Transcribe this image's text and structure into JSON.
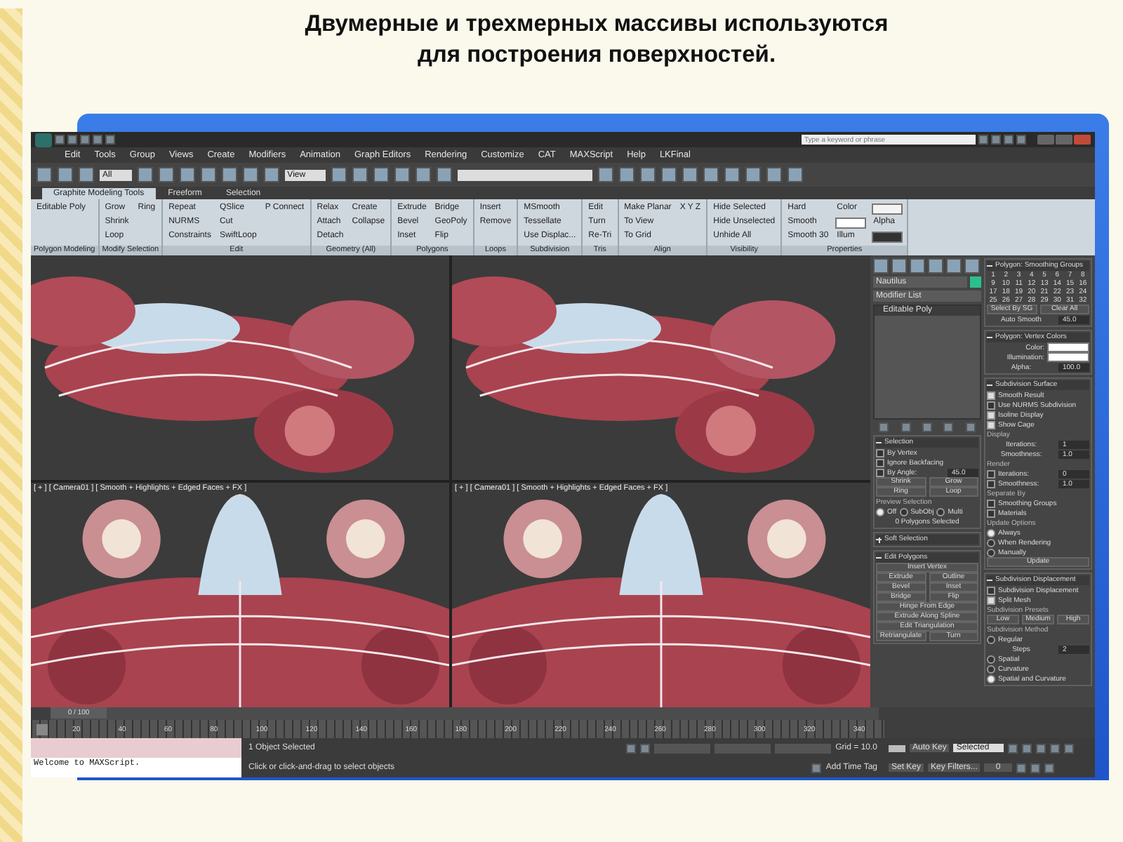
{
  "slide": {
    "title": "Двумерные и трехмерных массивы используются для построения поверхностей."
  },
  "app": {
    "search": {
      "placeholder": "Type a keyword or phrase"
    },
    "menu": [
      "Edit",
      "Tools",
      "Group",
      "Views",
      "Create",
      "Modifiers",
      "Animation",
      "Graph Editors",
      "Rendering",
      "Customize",
      "CAT",
      "MAXScript",
      "Help",
      "LKFinal"
    ],
    "toolbar": {
      "selection_filter": "All",
      "reference_coord": "View"
    },
    "ribbon_tabs": [
      {
        "label": "Graphite Modeling Tools",
        "selected": true
      },
      {
        "label": "Freeform",
        "selected": false
      },
      {
        "label": "Selection",
        "selected": false
      }
    ],
    "ribbon_groups": [
      {
        "label": "Polygon Modeling",
        "items": [
          {
            "text": "Editable Poly"
          }
        ]
      },
      {
        "label": "Modify Selection",
        "items": [
          {
            "text": "Grow"
          },
          {
            "text": "Shrink"
          },
          {
            "text": "Loop"
          },
          {
            "text": "Ring"
          }
        ]
      },
      {
        "label": "Edit",
        "items": [
          {
            "text": "Repeat"
          },
          {
            "text": "NURMS"
          },
          {
            "text": "Constraints"
          },
          {
            "text": "QSlice"
          },
          {
            "text": "Cut"
          },
          {
            "text": "SwiftLoop"
          },
          {
            "text": "P Connect"
          }
        ]
      },
      {
        "label": "Geometry (All)",
        "items": [
          {
            "text": "Relax"
          },
          {
            "text": "Attach"
          },
          {
            "text": "Detach"
          },
          {
            "text": "Create"
          },
          {
            "text": "Collapse"
          }
        ]
      },
      {
        "label": "Polygons",
        "items": [
          {
            "text": "Extrude"
          },
          {
            "text": "Bevel"
          },
          {
            "text": "Inset"
          },
          {
            "text": "Bridge"
          },
          {
            "text": "GeoPoly"
          },
          {
            "text": "Flip"
          }
        ]
      },
      {
        "label": "Loops",
        "items": [
          {
            "text": "Insert"
          },
          {
            "text": "Remove"
          }
        ]
      },
      {
        "label": "Subdivision",
        "items": [
          {
            "text": "MSmooth"
          },
          {
            "text": "Tessellate"
          },
          {
            "text": "Use Displac..."
          }
        ]
      },
      {
        "label": "Tris",
        "items": [
          {
            "text": "Edit"
          },
          {
            "text": "Turn"
          },
          {
            "text": "Re-Tri"
          }
        ]
      },
      {
        "label": "Align",
        "items": [
          {
            "text": "Make Planar"
          },
          {
            "text": "To View"
          },
          {
            "text": "To Grid"
          },
          {
            "text": "X Y Z"
          }
        ]
      },
      {
        "label": "Visibility",
        "items": [
          {
            "text": "Hide Selected"
          },
          {
            "text": "Hide Unselected"
          },
          {
            "text": "Unhide All"
          }
        ]
      },
      {
        "label": "Properties",
        "items": [
          {
            "text": "Hard"
          },
          {
            "text": "Smooth"
          },
          {
            "text": "Smooth 30"
          },
          {
            "text": "Color",
            "kind": "swatch",
            "color": "#ffffff"
          },
          {
            "text": "Illum",
            "kind": "swatch",
            "color": "#f4f4f4"
          },
          {
            "text": "Alpha",
            "kind": "swatch",
            "color": "#333333"
          }
        ]
      }
    ],
    "viewports": [
      {
        "kind": "picture"
      },
      {
        "kind": "picture"
      },
      {
        "kind": "picture",
        "label": "[ + ] [ Camera01 ] [ Smooth + Highlights + Edged Faces + FX ]"
      },
      {
        "kind": "picture",
        "label": "[ + ] [ Camera01 ] [ Smooth + Highlights + Edged Faces + FX ]"
      }
    ],
    "command_panel": {
      "object_name": "Nautilus",
      "modifier_list": "Modifier List",
      "stack": [
        "Editable Poly"
      ],
      "left_rollouts": [
        {
          "title": "Selection",
          "expanded": true,
          "rows": [
            {
              "kind": "check",
              "text": "By Vertex",
              "checked": false
            },
            {
              "kind": "check",
              "text": "Ignore Backfacing",
              "checked": false
            },
            {
              "kind": "checkfield",
              "text": "By Angle:",
              "value": "45.0",
              "checked": false
            },
            {
              "kind": "buttons",
              "items": [
                "Shrink",
                "Grow"
              ]
            },
            {
              "kind": "buttons",
              "items": [
                "Ring",
                "Loop"
              ]
            },
            {
              "kind": "label",
              "text": "Preview Selection"
            },
            {
              "kind": "radios",
              "items": [
                {
                  "text": "Off",
                  "selected": true
                },
                {
                  "text": "SubObj",
                  "selected": false
                },
                {
                  "text": "Multi",
                  "selected": false
                }
              ]
            },
            {
              "kind": "note",
              "text": "0 Polygons Selected"
            }
          ]
        },
        {
          "title": "Soft Selection",
          "expanded": false
        },
        {
          "title": "Edit Polygons",
          "expanded": true,
          "rows": [
            {
              "kind": "buttons",
              "items": [
                "Insert Vertex"
              ]
            },
            {
              "kind": "buttons",
              "items": [
                "Extrude",
                "Outline"
              ]
            },
            {
              "kind": "buttons",
              "items": [
                "Bevel",
                "Inset"
              ]
            },
            {
              "kind": "buttons",
              "items": [
                "Bridge",
                "Flip"
              ]
            },
            {
              "kind": "buttons",
              "items": [
                "Hinge From Edge"
              ]
            },
            {
              "kind": "buttons",
              "items": [
                "Extrude Along Spline"
              ]
            },
            {
              "kind": "buttons",
              "items": [
                "Edit Triangulation"
              ]
            },
            {
              "kind": "buttons",
              "items": [
                "Retriangulate",
                "Turn"
              ]
            }
          ]
        }
      ],
      "right_rollouts": [
        {
          "title": "Polygon: Smoothing Groups",
          "expanded": true,
          "rows": [
            {
              "kind": "grid",
              "items": [
                "1",
                "2",
                "3",
                "4",
                "5",
                "6",
                "7",
                "8",
                "9",
                "10",
                "11",
                "12",
                "13",
                "14",
                "15",
                "16",
                "17",
                "18",
                "19",
                "20",
                "21",
                "22",
                "23",
                "24",
                "25",
                "26",
                "27",
                "28",
                "29",
                "30",
                "31",
                "32"
              ]
            },
            {
              "kind": "buttons",
              "items": [
                "Select By SG",
                "Clear All"
              ]
            },
            {
              "kind": "field",
              "text": "Auto Smooth",
              "value": "45.0"
            }
          ]
        },
        {
          "title": "Polygon: Vertex Colors",
          "expanded": true,
          "rows": [
            {
              "kind": "color",
              "text": "Color:",
              "color": "#ffffff"
            },
            {
              "kind": "color",
              "text": "Illumination:",
              "color": "#ffffff"
            },
            {
              "kind": "field",
              "text": "Alpha:",
              "value": "100.0"
            }
          ]
        },
        {
          "title": "Subdivision Surface",
          "expanded": true,
          "rows": [
            {
              "kind": "check",
              "text": "Smooth Result",
              "checked": true
            },
            {
              "kind": "check",
              "text": "Use NURMS Subdivision",
              "checked": false
            },
            {
              "kind": "check",
              "text": "Isoline Display",
              "checked": true
            },
            {
              "kind": "check",
              "text": "Show Cage",
              "checked": true
            },
            {
              "kind": "label",
              "text": "Display"
            },
            {
              "kind": "field",
              "text": "Iterations:",
              "value": "1"
            },
            {
              "kind": "field",
              "text": "Smoothness:",
              "value": "1.0"
            },
            {
              "kind": "label",
              "text": "Render"
            },
            {
              "kind": "checkfield",
              "text": "Iterations:",
              "value": "0",
              "checked": false
            },
            {
              "kind": "checkfield",
              "text": "Smoothness:",
              "value": "1.0",
              "checked": false
            },
            {
              "kind": "label",
              "text": "Separate By"
            },
            {
              "kind": "check",
              "text": "Smoothing Groups",
              "checked": false
            },
            {
              "kind": "check",
              "text": "Materials",
              "checked": false
            },
            {
              "kind": "label",
              "text": "Update Options"
            },
            {
              "kind": "radio",
              "text": "Always",
              "selected": true
            },
            {
              "kind": "radio",
              "text": "When Rendering",
              "selected": false
            },
            {
              "kind": "radio",
              "text": "Manually",
              "selected": false
            },
            {
              "kind": "buttons",
              "items": [
                "Update"
              ]
            }
          ]
        },
        {
          "title": "Subdivision Displacement",
          "expanded": true,
          "rows": [
            {
              "kind": "check",
              "text": "Subdivision Displacement",
              "checked": false
            },
            {
              "kind": "check",
              "text": "Split Mesh",
              "checked": true
            },
            {
              "kind": "label",
              "text": "Subdivision Presets"
            },
            {
              "kind": "buttons",
              "items": [
                "Low",
                "Medium",
                "High"
              ]
            },
            {
              "kind": "label",
              "text": "Subdivision Method"
            },
            {
              "kind": "radio",
              "text": "Regular",
              "selected": false
            },
            {
              "kind": "field",
              "text": "Steps",
              "value": "2"
            },
            {
              "kind": "radio",
              "text": "Spatial",
              "selected": false
            },
            {
              "kind": "radio",
              "text": "Curvature",
              "selected": false
            },
            {
              "kind": "radio",
              "text": "Spatial and Curvature",
              "selected": true
            }
          ]
        }
      ]
    },
    "timeline": {
      "slider": "0 / 100",
      "level": 0,
      "ticks": [
        "20",
        "40",
        "60",
        "80",
        "100",
        "120",
        "140",
        "160",
        "180",
        "200",
        "220",
        "240",
        "260",
        "280",
        "300",
        "320",
        "340"
      ]
    },
    "status": {
      "listener": "Welcome to MAXScript.",
      "selection": "1 Object Selected",
      "prompt": "Click or click-and-drag to select objects",
      "grid": "Grid = 10.0",
      "time_tag": "Add Time Tag",
      "auto_key": "Auto Key",
      "key_mode": "Selected",
      "set_key": "Set Key",
      "key_filters": "Key Filters...",
      "frame": "0"
    }
  }
}
